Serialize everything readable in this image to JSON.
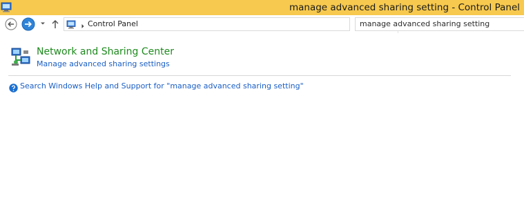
{
  "window": {
    "title": "manage advanced sharing setting - Control Panel",
    "titlebar_color": "#f7c94e",
    "app_icon": "control-panel-icon"
  },
  "navigation": {
    "back_icon": "back-arrow-icon",
    "forward_icon": "forward-arrow-icon",
    "recent_icon": "chevron-down-icon",
    "up_icon": "up-arrow-icon"
  },
  "address_bar": {
    "icon": "control-panel-icon",
    "separator_icon": "chevron-right-icon",
    "path": "Control Panel",
    "dropdown_icon": "chevron-down-icon",
    "refresh_icon": "refresh-icon"
  },
  "search": {
    "value": "manage advanced sharing setting"
  },
  "results": [
    {
      "category": "Network and Sharing Center",
      "link": "Manage advanced sharing settings",
      "icon": "network-icon",
      "category_color": "#1e8a1e"
    }
  ],
  "help": {
    "icon": "help-icon",
    "text": "Search Windows Help and Support for \"manage advanced sharing setting\"",
    "link_color": "#1a5ec4"
  }
}
